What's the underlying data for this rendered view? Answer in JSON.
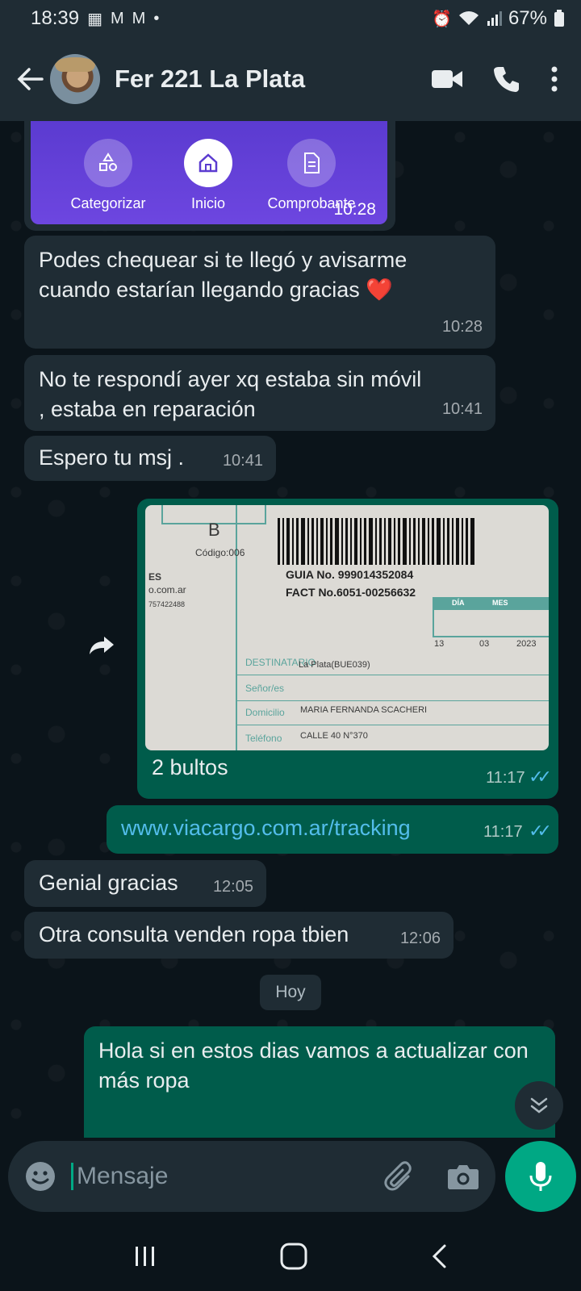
{
  "status_bar": {
    "time": "18:39",
    "battery": "67%"
  },
  "header": {
    "contact_name": "Fer 221 La Plata"
  },
  "preview_card": {
    "nav": [
      "Categorizar",
      "Inicio",
      "Comprobante"
    ],
    "time": "10:28"
  },
  "messages": [
    {
      "dir": "in",
      "text": "Podes chequear si te llegó y avisarme cuando estarían llegando gracias ❤️",
      "time": "10:28"
    },
    {
      "dir": "in",
      "text": "No te respondí ayer xq estaba sin móvil , estaba en reparación",
      "time": "10:41"
    },
    {
      "dir": "in",
      "text": "Espero tu msj .",
      "time": "10:41"
    },
    {
      "dir": "out",
      "text": "2 bultos",
      "time": "11:17"
    },
    {
      "dir": "out",
      "text": "www.viacargo.com.ar/tracking",
      "time": "11:17"
    },
    {
      "dir": "in",
      "text": "Genial gracias",
      "time": "12:05"
    },
    {
      "dir": "in",
      "text": "Otra consulta venden ropa tbien",
      "time": "12:06"
    },
    {
      "dir": "out",
      "text": "Hola si en estos dias vamos a actualizar con más ropa",
      "time": ""
    }
  ],
  "photo": {
    "letter": "B",
    "codigo": "Código:006",
    "guia": "GUIA No. 999014352084",
    "fact": "FACT No.6051-00256632",
    "dia": "DÍA",
    "mes": "MES",
    "d1": "13",
    "d2": "03",
    "d3": "2023",
    "destinatario": "DESTINATARIO",
    "destino": "La Plata(BUE039)",
    "senor": "Señor/es",
    "domicilio": "Domicilio",
    "nombre": "MARIA FERNANDA SCACHERI",
    "telefono": "Teléfono",
    "calle": "CALLE 40 N°370",
    "es": "ES",
    "comar": "o.com.ar",
    "num": "757422488"
  },
  "day_divider": "Hoy",
  "composer": {
    "placeholder": "Mensaje"
  }
}
